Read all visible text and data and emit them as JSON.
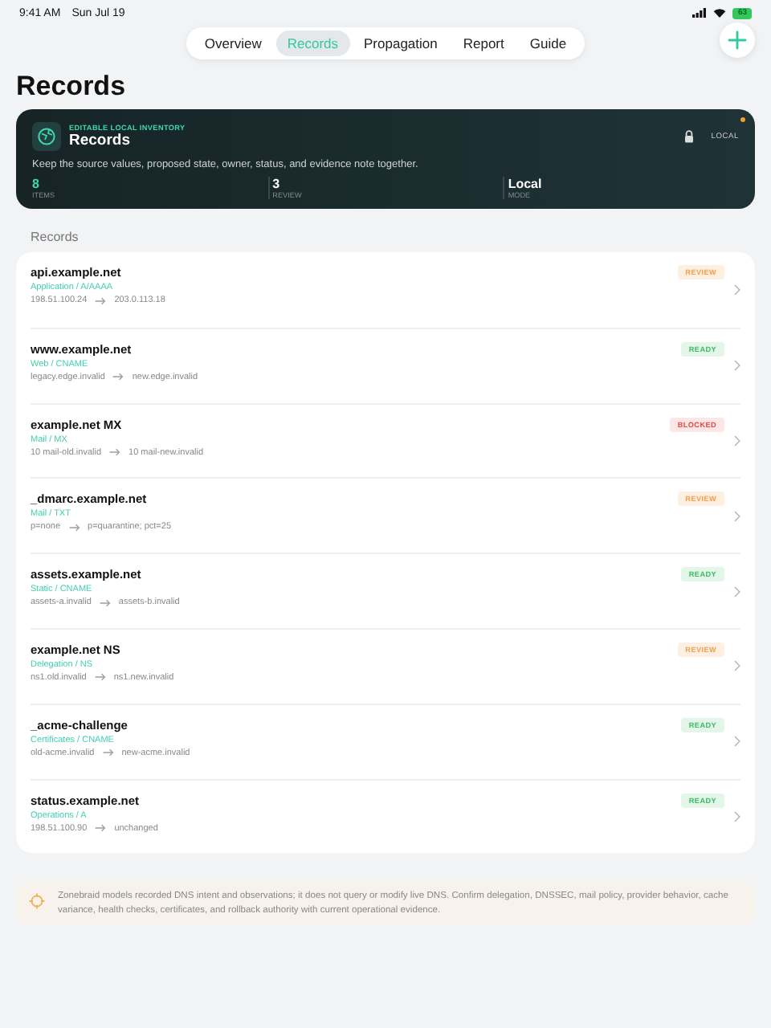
{
  "status_bar": {
    "time": "9:41 AM",
    "date": "Sun Jul 19",
    "battery": "63"
  },
  "tabs": [
    {
      "label": "Overview",
      "selected": false
    },
    {
      "label": "Records",
      "selected": true
    },
    {
      "label": "Propagation",
      "selected": false
    },
    {
      "label": "Report",
      "selected": false
    },
    {
      "label": "Guide",
      "selected": false
    }
  ],
  "page_title": "Records",
  "hero": {
    "eyebrow": "EDITABLE LOCAL INVENTORY",
    "title": "Records",
    "badge": "LOCAL",
    "description": "Keep the source values, proposed state, owner, status, and evidence note together.",
    "stats": [
      {
        "value": "8",
        "label": "ITEMS",
        "accent": true
      },
      {
        "value": "3",
        "label": "REVIEW",
        "accent": false
      },
      {
        "value": "Local",
        "label": "MODE",
        "accent": false
      }
    ]
  },
  "section_title": "Records",
  "records": [
    {
      "name": "api.example.net",
      "type": "Application / A/AAAA",
      "from": "198.51.100.24",
      "to": "203.0.113.18",
      "status": "REVIEW",
      "kind": "review"
    },
    {
      "name": "www.example.net",
      "type": "Web / CNAME",
      "from": "legacy.edge.invalid",
      "to": "new.edge.invalid",
      "status": "READY",
      "kind": "ready"
    },
    {
      "name": "example.net MX",
      "type": "Mail / MX",
      "from": "10 mail-old.invalid",
      "to": "10 mail-new.invalid",
      "status": "BLOCKED",
      "kind": "blocked"
    },
    {
      "name": "_dmarc.example.net",
      "type": "Mail / TXT",
      "from": "p=none",
      "to": "p=quarantine; pct=25",
      "status": "REVIEW",
      "kind": "review"
    },
    {
      "name": "assets.example.net",
      "type": "Static / CNAME",
      "from": "assets-a.invalid",
      "to": "assets-b.invalid",
      "status": "READY",
      "kind": "ready"
    },
    {
      "name": "example.net NS",
      "type": "Delegation / NS",
      "from": "ns1.old.invalid",
      "to": "ns1.new.invalid",
      "status": "REVIEW",
      "kind": "review"
    },
    {
      "name": "_acme-challenge",
      "type": "Certificates / CNAME",
      "from": "old-acme.invalid",
      "to": "new-acme.invalid",
      "status": "READY",
      "kind": "ready"
    },
    {
      "name": "status.example.net",
      "type": "Operations / A",
      "from": "198.51.100.90",
      "to": "unchanged",
      "status": "READY",
      "kind": "ready"
    }
  ],
  "notice": "Zonebraid models recorded DNS intent and observations; it does not query or modify live DNS. Confirm delegation, DNSSEC, mail policy, provider behavior, cache variance, health checks, certificates, and rollback authority with current operational evidence."
}
